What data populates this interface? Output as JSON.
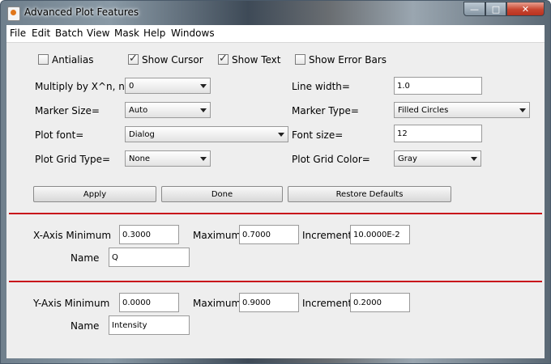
{
  "window": {
    "title": "Advanced Plot Features",
    "min_glyph": "—",
    "max_glyph": "□",
    "close_glyph": "✕"
  },
  "menu": [
    "File",
    "Edit",
    "Batch",
    "View",
    "Mask",
    "Help",
    "Windows"
  ],
  "checkboxes": {
    "antialias": {
      "label": "Antialias",
      "checked": false
    },
    "show_cursor": {
      "label": "Show Cursor",
      "checked": true
    },
    "show_text": {
      "label": "Show Text",
      "checked": true
    },
    "show_error_bars": {
      "label": "Show Error Bars",
      "checked": false
    }
  },
  "settings": {
    "multiply": {
      "label": "Multiply by X^n, n =",
      "value": "0"
    },
    "line_width": {
      "label": "Line width=",
      "value": "1.0"
    },
    "marker_size": {
      "label": "Marker Size=",
      "value": "Auto"
    },
    "marker_type": {
      "label": "Marker Type=",
      "value": "Filled Circles"
    },
    "plot_font": {
      "label": "Plot font=",
      "value": "Dialog"
    },
    "font_size": {
      "label": "Font size=",
      "value": "12"
    },
    "grid_type": {
      "label": "Plot Grid Type=",
      "value": "None"
    },
    "grid_color": {
      "label": "Plot Grid Color=",
      "value": "Gray"
    }
  },
  "buttons": {
    "apply": "Apply",
    "done": "Done",
    "restore": "Restore Defaults"
  },
  "x_axis": {
    "min_label": "X-Axis Minimum",
    "min": "0.3000",
    "max_label": "Maximum",
    "max": "0.7000",
    "inc_label": "Increment",
    "inc": "10.0000E-2",
    "name_label": "Name",
    "name": "Q"
  },
  "y_axis": {
    "min_label": "Y-Axis Minimum",
    "min": "0.0000",
    "max_label": "Maximum",
    "max": "0.9000",
    "inc_label": "Increment",
    "inc": "0.2000",
    "name_label": "Name",
    "name": "Intensity"
  },
  "colors": {
    "separator": "#c8101a",
    "panel": "#eeeeee"
  }
}
